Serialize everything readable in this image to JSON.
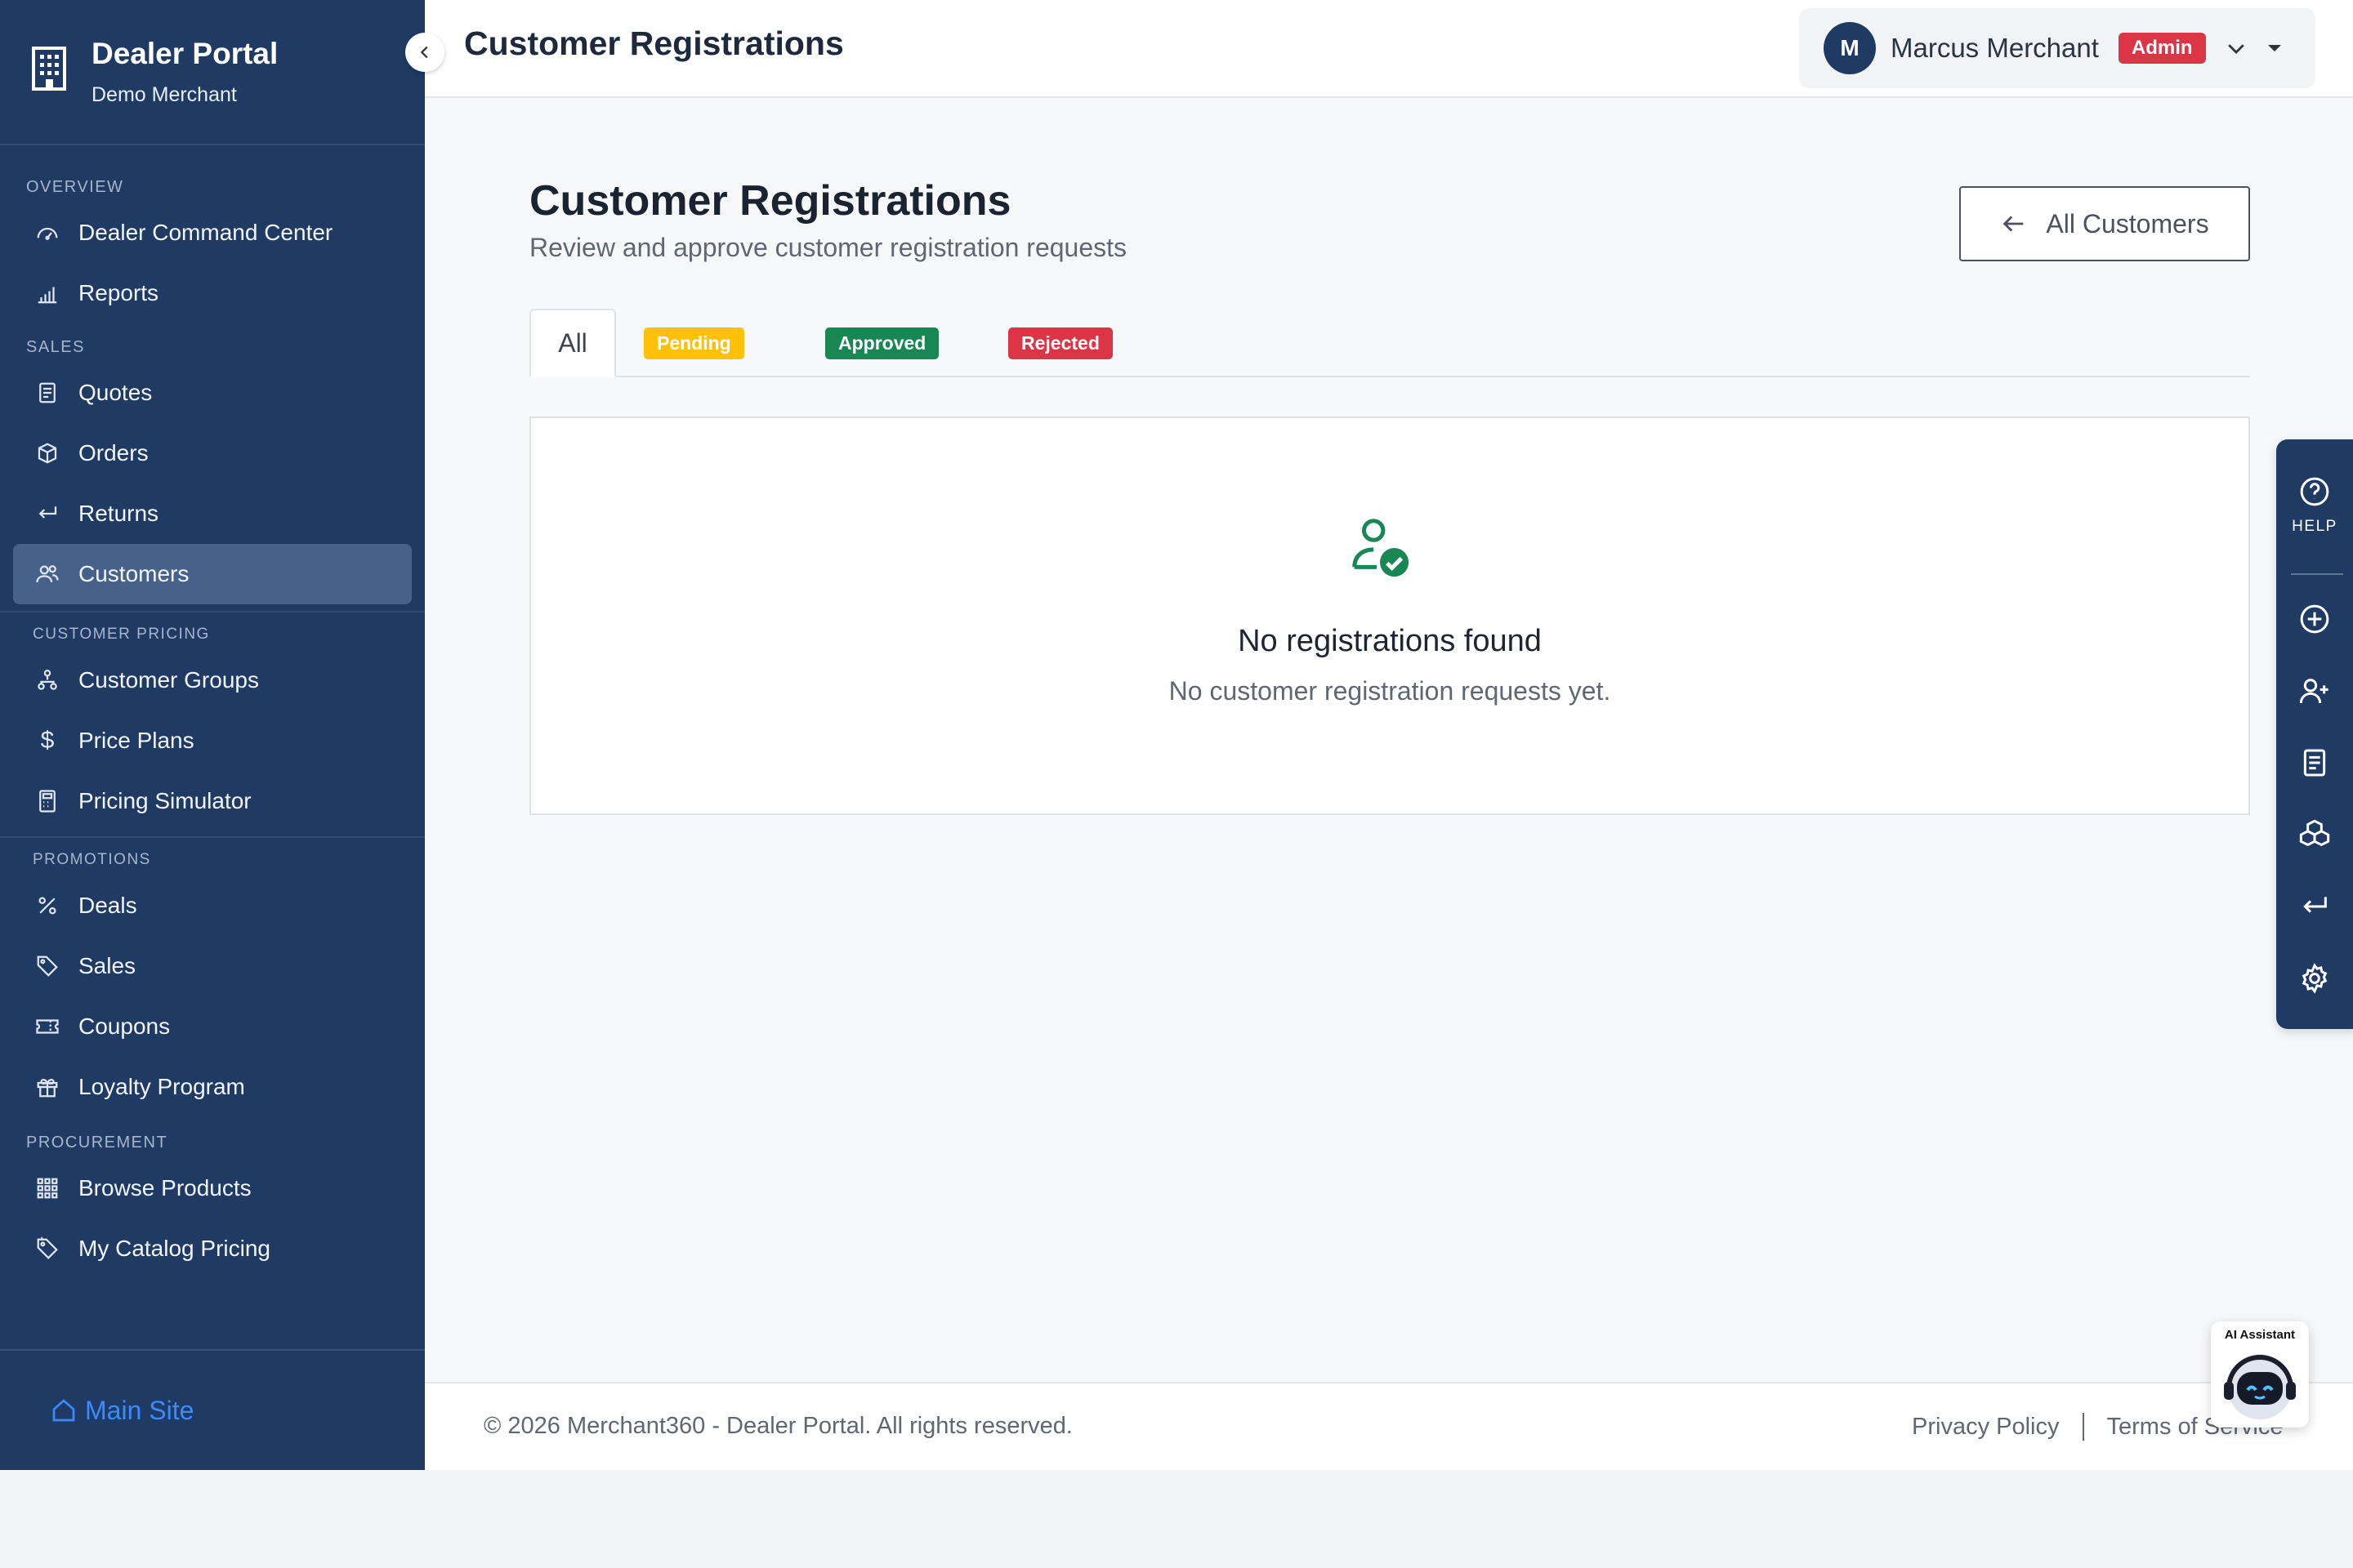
{
  "sidebar": {
    "brand_title": "Dealer Portal",
    "brand_sub": "Demo Merchant",
    "sections": {
      "overview": "OVERVIEW",
      "sales": "SALES",
      "customer_pricing": "CUSTOMER PRICING",
      "promotions": "PROMOTIONS",
      "procurement": "PROCUREMENT"
    },
    "items": {
      "command_center": "Dealer Command Center",
      "reports": "Reports",
      "quotes": "Quotes",
      "orders": "Orders",
      "returns": "Returns",
      "customers": "Customers",
      "customer_groups": "Customer Groups",
      "price_plans": "Price Plans",
      "pricing_simulator": "Pricing Simulator",
      "deals": "Deals",
      "sales": "Sales",
      "coupons": "Coupons",
      "loyalty_program": "Loyalty Program",
      "browse_products": "Browse Products",
      "my_catalog_pricing": "My Catalog Pricing"
    },
    "active_item": "Customers",
    "main_site": "Main Site"
  },
  "header": {
    "title": "Customer Registrations",
    "user": {
      "initial": "M",
      "name": "Marcus Merchant",
      "role": "Admin"
    }
  },
  "main": {
    "title": "Customer Registrations",
    "subtitle": "Review and approve customer registration requests",
    "back_button": "All Customers",
    "tabs": {
      "all": "All",
      "pending": "Pending",
      "approved": "Approved",
      "rejected": "Rejected"
    },
    "active_tab": "All",
    "empty": {
      "title": "No registrations found",
      "subtitle": "No customer registration requests yet."
    }
  },
  "footer": {
    "copyright": "© 2026 Merchant360 - Dealer Portal. All rights reserved.",
    "privacy": "Privacy Policy",
    "terms": "Terms of Service"
  },
  "rail": {
    "help": "HELP",
    "icons": [
      "help-icon",
      "add-circle-icon",
      "add-user-icon",
      "document-icon",
      "boxes-icon",
      "return-icon",
      "gear-icon"
    ]
  },
  "ai_assistant": {
    "label": "AI Assistant"
  },
  "colors": {
    "sidebar_bg": "#1f3a63",
    "sidebar_active": "#47628a",
    "pending": "#ffc107",
    "approved": "#198754",
    "rejected": "#dc3545",
    "link": "#3b8bff"
  }
}
